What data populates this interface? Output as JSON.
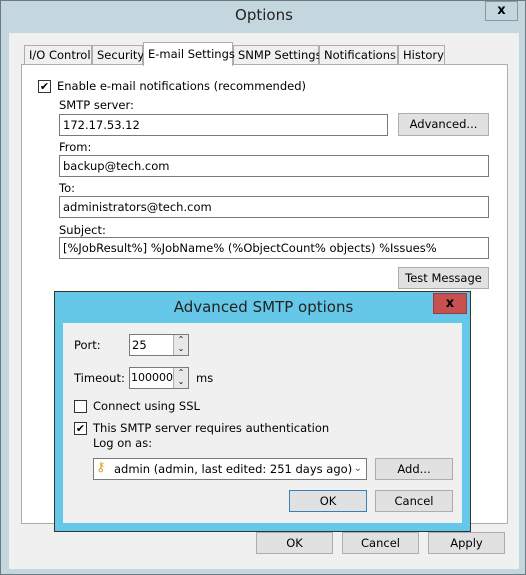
{
  "window": {
    "title": "Options",
    "close_label": "x"
  },
  "tabs": [
    {
      "label": "I/O Control"
    },
    {
      "label": "Security"
    },
    {
      "label": "E-mail Settings",
      "active": true
    },
    {
      "label": "SNMP Settings"
    },
    {
      "label": "Notifications"
    },
    {
      "label": "History"
    }
  ],
  "email": {
    "enable_label": "Enable e-mail notifications (recommended)",
    "enable_checked": true,
    "smtp_label": "SMTP server:",
    "smtp_value": "172.17.53.12",
    "advanced_label": "Advanced...",
    "from_label": "From:",
    "from_value": "backup@tech.com",
    "to_label": "To:",
    "to_value": "administrators@tech.com",
    "subject_label": "Subject:",
    "subject_value": "[%JobResult%] %JobName% (%ObjectCount% objects) %Issues%",
    "test_label": "Test Message"
  },
  "footer": {
    "ok": "OK",
    "cancel": "Cancel",
    "apply": "Apply"
  },
  "dialog": {
    "title": "Advanced SMTP options",
    "close_label": "x",
    "port_label": "Port:",
    "port_value": "25",
    "timeout_label": "Timeout:",
    "timeout_value": "100000",
    "timeout_unit": "ms",
    "ssl_label": "Connect using SSL",
    "ssl_checked": false,
    "auth_label": "This SMTP server requires authentication",
    "auth_checked": true,
    "logon_label": "Log on as:",
    "logon_value": "admin (admin, last edited: 251 days ago)",
    "add_label": "Add...",
    "ok": "OK",
    "cancel": "Cancel",
    "accent": "#65c8e8",
    "close_color": "#c75050"
  }
}
